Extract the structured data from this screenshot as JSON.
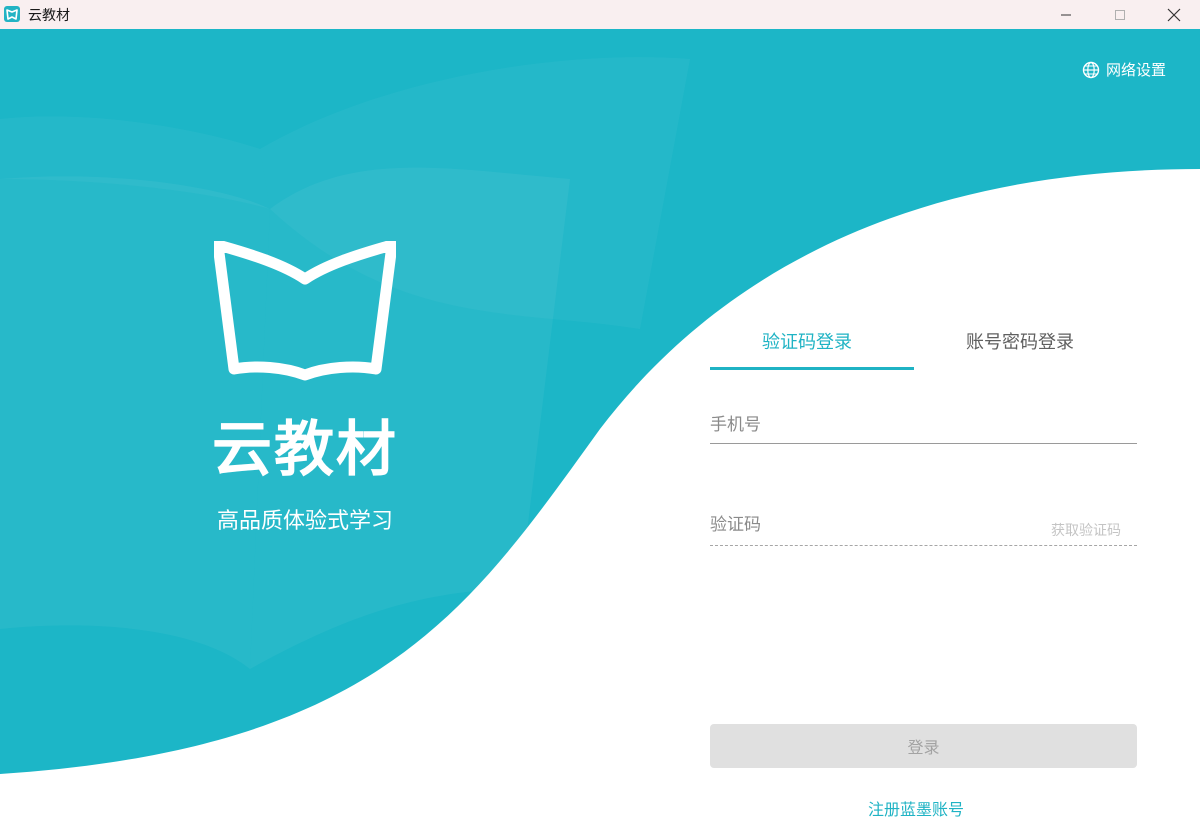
{
  "window": {
    "title": "云教材",
    "controls": {
      "minimize": "minimize-icon",
      "maximize": "maximize-icon",
      "close": "close-icon"
    }
  },
  "header": {
    "network_settings_label": "网络设置",
    "network_settings_icon": "globe-icon"
  },
  "brand": {
    "logo_icon": "open-book-icon",
    "name": "云教材",
    "slogan": "高品质体验式学习"
  },
  "login": {
    "tabs": [
      {
        "label": "验证码登录",
        "active": true
      },
      {
        "label": "账号密码登录",
        "active": false
      }
    ],
    "phone_placeholder": "手机号",
    "code_placeholder": "验证码",
    "get_code_label": "获取验证码",
    "submit_label": "登录",
    "register_label": "注册蓝墨账号"
  },
  "colors": {
    "accent": "#1fb3c4",
    "background_teal": "#1cb6c7",
    "disabled_button": "#e0e0e0"
  }
}
